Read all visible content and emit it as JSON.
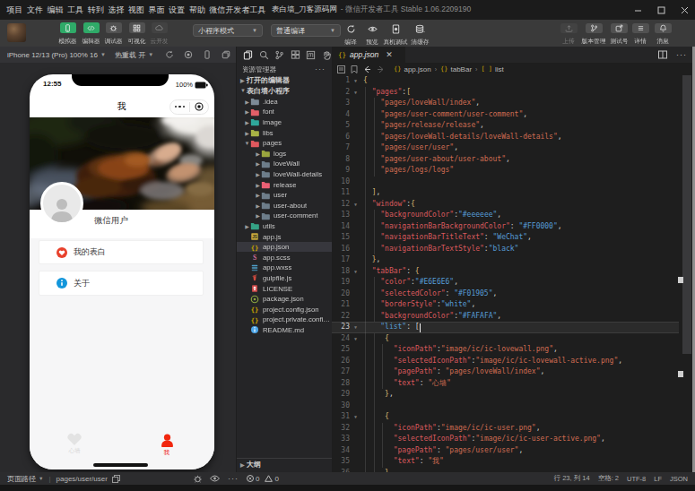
{
  "colors": {
    "accent_green": "#2faa68",
    "wechat_red": "#ee2a1d",
    "info_blue": "#1296db",
    "editor_key": "#d9595d",
    "editor_string": "#cf6c52",
    "editor_value_blue": "#569cd6",
    "editor_brace": "#d8b878"
  },
  "titlebar": {
    "menu": [
      "项目",
      "文件",
      "编辑",
      "工具",
      "转到",
      "选择",
      "视图",
      "界面",
      "设置",
      "帮助",
      "微信开发者工具"
    ],
    "title_main": "表白墙_刀客源码网",
    "title_sub": "- 微信开发者工具 Stable 1.06.2209190",
    "window_buttons": [
      "minimize",
      "maximize",
      "close"
    ]
  },
  "toolbar": {
    "mode_buttons": [
      {
        "label": "模拟器",
        "icon": "phone-icon",
        "state": "on"
      },
      {
        "label": "编辑器",
        "icon": "code-icon",
        "state": "on"
      },
      {
        "label": "调试器",
        "icon": "bug-icon",
        "state": "off"
      },
      {
        "label": "可视化",
        "icon": "grid-icon",
        "state": "off"
      },
      {
        "label": "云开发",
        "icon": "cloud-icon",
        "state": "disabled"
      }
    ],
    "selects": [
      {
        "value": "小程序模式"
      },
      {
        "value": "普通编译"
      }
    ],
    "action_buttons": [
      {
        "label": "编译",
        "icon": "compile-icon"
      },
      {
        "label": "预览",
        "icon": "eye-icon"
      },
      {
        "label": "真机调试",
        "icon": "device-debug-icon"
      },
      {
        "label": "清缓存",
        "icon": "cache-icon"
      }
    ],
    "right_buttons": [
      {
        "label": "上传",
        "icon": "upload-icon",
        "disabled": true
      },
      {
        "label": "版本管理",
        "icon": "branch-icon",
        "disabled": false
      },
      {
        "label": "测试号",
        "icon": "share-icon",
        "disabled": false
      },
      {
        "label": "详情",
        "icon": "details-icon",
        "disabled": false
      },
      {
        "label": "消息",
        "icon": "bell-icon",
        "disabled": false
      }
    ]
  },
  "simulator": {
    "device_label": "iPhone 12/13 (Pro) 100% 16",
    "hot_reload_label": "热重载 开",
    "header_icons": [
      "refresh-icon",
      "record-icon",
      "device-icon",
      "multi-window-icon"
    ],
    "phone": {
      "time": "12:55",
      "battery": "100%",
      "nav_title": "我",
      "user_name": "微信用户",
      "menu_items": [
        {
          "label": "我的表白",
          "icon": "heart-circle-icon"
        },
        {
          "label": "关于",
          "icon": "info-circle-icon"
        }
      ],
      "tabbar": [
        {
          "label": "心墙",
          "icon": "heart-icon",
          "active": false
        },
        {
          "label": "我",
          "icon": "user-icon",
          "active": true
        }
      ]
    },
    "page_path_label": "页面路径",
    "page_path": "pages/user/user"
  },
  "explorer": {
    "strip_icons": [
      "files-icon",
      "search-icon",
      "git-branch-icon",
      "extensions-icon",
      "npm-icon",
      "hand-icon"
    ],
    "header": "资源管理器",
    "sections": [
      "打开的编辑器",
      "表白墙小程序"
    ],
    "outline": "大纲",
    "problems": {
      "errors": "0",
      "warnings": "0"
    },
    "tree": [
      {
        "label": ".idea",
        "lvl": 1,
        "kind": "folder",
        "color": "#7d8a96",
        "arrow": "closed"
      },
      {
        "label": "font",
        "lvl": 1,
        "kind": "folder",
        "color": "#e25f68",
        "arrow": "closed"
      },
      {
        "label": "image",
        "lvl": 1,
        "kind": "folder",
        "color": "#2fa79b",
        "arrow": "closed"
      },
      {
        "label": "libs",
        "lvl": 1,
        "kind": "folder",
        "color": "#a8b345",
        "arrow": "closed"
      },
      {
        "label": "pages",
        "lvl": 1,
        "kind": "folder",
        "color": "#e0585e",
        "arrow": "open"
      },
      {
        "label": "logs",
        "lvl": 2,
        "kind": "folder",
        "color": "#9aa63e",
        "arrow": "closed"
      },
      {
        "label": "loveWall",
        "lvl": 2,
        "kind": "folder",
        "color": "#6d7d8a",
        "arrow": "closed"
      },
      {
        "label": "loveWall-details",
        "lvl": 2,
        "kind": "folder",
        "color": "#6d7d8a",
        "arrow": "closed"
      },
      {
        "label": "release",
        "lvl": 2,
        "kind": "folder",
        "color": "#ea5f74",
        "arrow": "closed"
      },
      {
        "label": "user",
        "lvl": 2,
        "kind": "folder",
        "color": "#6d7d8a",
        "arrow": "closed"
      },
      {
        "label": "user-about",
        "lvl": 2,
        "kind": "folder",
        "color": "#6d7d8a",
        "arrow": "closed"
      },
      {
        "label": "user-comment",
        "lvl": 2,
        "kind": "folder",
        "color": "#6d7d8a",
        "arrow": "closed"
      },
      {
        "label": "utils",
        "lvl": 1,
        "kind": "folder",
        "color": "#35a285",
        "arrow": "closed"
      },
      {
        "label": "app.js",
        "lvl": 1,
        "kind": "js",
        "color": "#c7a93c"
      },
      {
        "label": "app.json",
        "lvl": 1,
        "kind": "json",
        "color": "#cca700",
        "selected": true
      },
      {
        "label": "app.scss",
        "lvl": 1,
        "kind": "scss",
        "color": "#d16d9e"
      },
      {
        "label": "app.wxss",
        "lvl": 1,
        "kind": "wxss",
        "color": "#4f9fc9"
      },
      {
        "label": "gulpfile.js",
        "lvl": 1,
        "kind": "gulp",
        "color": "#cf4a3f"
      },
      {
        "label": "LICENSE",
        "lvl": 1,
        "kind": "license",
        "color": "#d04a4a"
      },
      {
        "label": "package.json",
        "lvl": 1,
        "kind": "npm",
        "color": "#8aa53f"
      },
      {
        "label": "project.config.json",
        "lvl": 1,
        "kind": "json",
        "color": "#cca700"
      },
      {
        "label": "project.private.config.js...",
        "lvl": 1,
        "kind": "json",
        "color": "#cca700"
      },
      {
        "label": "README.md",
        "lvl": 1,
        "kind": "readme",
        "color": "#4da6e8"
      }
    ]
  },
  "editor": {
    "tab": {
      "name": "app.json",
      "icon": "braces-icon"
    },
    "strip_icons": [
      "split-editor-icon",
      "more-icon"
    ],
    "breadcrumb_icons": [
      "list-flat-icon",
      "bookmark-icon",
      "arrow-left-icon",
      "arrow-right-icon"
    ],
    "breadcrumb": [
      {
        "icon": "{}",
        "label": "app.json"
      },
      {
        "icon": "{}",
        "label": "tabBar"
      },
      {
        "icon": "[ ]",
        "label": "list"
      }
    ],
    "cursor": {
      "line": "23",
      "col": "14"
    },
    "lines": [
      {
        "n": "1",
        "fold": true,
        "t": [
          [
            "brace",
            "{"
          ]
        ]
      },
      {
        "n": "2",
        "fold": true,
        "t": [
          [
            "punct",
            "  "
          ],
          [
            "key",
            "\"pages\""
          ],
          [
            "punct",
            ":"
          ],
          [
            "brace",
            "["
          ]
        ]
      },
      {
        "n": "3",
        "t": [
          [
            "punct",
            "    "
          ],
          [
            "str",
            "\"pages/loveWall/index\""
          ],
          [
            "punct",
            ","
          ]
        ]
      },
      {
        "n": "4",
        "t": [
          [
            "punct",
            "    "
          ],
          [
            "str",
            "\"pages/user-comment/user-comment\""
          ],
          [
            "punct",
            ","
          ]
        ]
      },
      {
        "n": "5",
        "t": [
          [
            "punct",
            "    "
          ],
          [
            "str",
            "\"pages/release/release\""
          ],
          [
            "punct",
            ","
          ]
        ]
      },
      {
        "n": "6",
        "t": [
          [
            "punct",
            "    "
          ],
          [
            "str",
            "\"pages/loveWall-details/loveWall-details\""
          ],
          [
            "punct",
            ","
          ]
        ]
      },
      {
        "n": "7",
        "t": [
          [
            "punct",
            "    "
          ],
          [
            "str",
            "\"pages/user/user\""
          ],
          [
            "punct",
            ","
          ]
        ]
      },
      {
        "n": "8",
        "t": [
          [
            "punct",
            "    "
          ],
          [
            "str",
            "\"pages/user-about/user-about\""
          ],
          [
            "punct",
            ","
          ]
        ]
      },
      {
        "n": "9",
        "t": [
          [
            "punct",
            "    "
          ],
          [
            "str",
            "\"pages/logs/logs\""
          ]
        ]
      },
      {
        "n": "10",
        "t": []
      },
      {
        "n": "11",
        "t": [
          [
            "punct",
            "  "
          ],
          [
            "brace",
            "]"
          ],
          [
            "punct",
            ","
          ]
        ]
      },
      {
        "n": "12",
        "fold": true,
        "t": [
          [
            "punct",
            "  "
          ],
          [
            "key",
            "\"window\""
          ],
          [
            "punct",
            ":"
          ],
          [
            "brace",
            "{"
          ]
        ]
      },
      {
        "n": "13",
        "t": [
          [
            "punct",
            "    "
          ],
          [
            "key",
            "\"backgroundColor\""
          ],
          [
            "punct",
            ":"
          ],
          [
            "blue",
            "\"#eeeeee\""
          ],
          [
            "punct",
            ","
          ]
        ]
      },
      {
        "n": "14",
        "t": [
          [
            "punct",
            "    "
          ],
          [
            "key",
            "\"navigationBarBackgroundColor\""
          ],
          [
            "punct",
            ": "
          ],
          [
            "blue",
            "\"#FF0000\""
          ],
          [
            "punct",
            ","
          ]
        ]
      },
      {
        "n": "15",
        "t": [
          [
            "punct",
            "    "
          ],
          [
            "key",
            "\"navigationBarTitleText\""
          ],
          [
            "punct",
            ": "
          ],
          [
            "blue",
            "\"WeChat\""
          ],
          [
            "punct",
            ","
          ]
        ]
      },
      {
        "n": "16",
        "t": [
          [
            "punct",
            "    "
          ],
          [
            "key",
            "\"navigationBarTextStyle\""
          ],
          [
            "punct",
            ":"
          ],
          [
            "blue",
            "\"black\""
          ]
        ]
      },
      {
        "n": "17",
        "t": [
          [
            "punct",
            "  "
          ],
          [
            "brace",
            "}"
          ],
          [
            "punct",
            ","
          ]
        ]
      },
      {
        "n": "18",
        "fold": true,
        "t": [
          [
            "punct",
            "  "
          ],
          [
            "key",
            "\"tabBar\""
          ],
          [
            "punct",
            ": "
          ],
          [
            "brace",
            "{"
          ]
        ]
      },
      {
        "n": "19",
        "t": [
          [
            "punct",
            "    "
          ],
          [
            "key",
            "\"color\""
          ],
          [
            "punct",
            ":"
          ],
          [
            "blue",
            "\"#E6E6E6\""
          ],
          [
            "punct",
            ","
          ]
        ]
      },
      {
        "n": "20",
        "t": [
          [
            "punct",
            "    "
          ],
          [
            "key",
            "\"selectedColor\""
          ],
          [
            "punct",
            ": "
          ],
          [
            "blue",
            "\"#F01905\""
          ],
          [
            "punct",
            ","
          ]
        ]
      },
      {
        "n": "21",
        "t": [
          [
            "punct",
            "    "
          ],
          [
            "key",
            "\"borderStyle\""
          ],
          [
            "punct",
            ":"
          ],
          [
            "blue",
            "\"white\""
          ],
          [
            "punct",
            ","
          ]
        ]
      },
      {
        "n": "22",
        "t": [
          [
            "punct",
            "    "
          ],
          [
            "key",
            "\"backgroundColor\""
          ],
          [
            "punct",
            ":"
          ],
          [
            "blue",
            "\"#FAFAFA\""
          ],
          [
            "punct",
            ","
          ]
        ]
      },
      {
        "n": "23",
        "fold": true,
        "cur": true,
        "t": [
          [
            "punct",
            "    "
          ],
          [
            "blue",
            "\"list\""
          ],
          [
            "punct",
            ": "
          ],
          [
            "punct",
            "["
          ]
        ]
      },
      {
        "n": "24",
        "fold": true,
        "t": [
          [
            "punct",
            "     "
          ],
          [
            "brace",
            "{"
          ]
        ]
      },
      {
        "n": "25",
        "t": [
          [
            "punct",
            "       "
          ],
          [
            "key",
            "\"iconPath\""
          ],
          [
            "punct",
            ":"
          ],
          [
            "str",
            "\"image/ic/ic-lovewall.png\""
          ],
          [
            "punct",
            ","
          ]
        ]
      },
      {
        "n": "26",
        "t": [
          [
            "punct",
            "       "
          ],
          [
            "key",
            "\"selectedIconPath\""
          ],
          [
            "punct",
            ":"
          ],
          [
            "str",
            "\"image/ic/ic-lovewall-active.png\""
          ],
          [
            "punct",
            ","
          ]
        ]
      },
      {
        "n": "27",
        "t": [
          [
            "punct",
            "       "
          ],
          [
            "key",
            "\"pagePath\""
          ],
          [
            "punct",
            ": "
          ],
          [
            "str",
            "\"pages/loveWall/index\""
          ],
          [
            "punct",
            ","
          ]
        ]
      },
      {
        "n": "28",
        "t": [
          [
            "punct",
            "       "
          ],
          [
            "key",
            "\"text\""
          ],
          [
            "punct",
            ": "
          ],
          [
            "str",
            "\"心墙\""
          ]
        ]
      },
      {
        "n": "29",
        "t": [
          [
            "punct",
            "     "
          ],
          [
            "brace",
            "}"
          ],
          [
            "punct",
            ","
          ]
        ]
      },
      {
        "n": "30",
        "t": []
      },
      {
        "n": "31",
        "fold": true,
        "t": [
          [
            "punct",
            "     "
          ],
          [
            "brace",
            "{"
          ]
        ]
      },
      {
        "n": "32",
        "t": [
          [
            "punct",
            "       "
          ],
          [
            "key",
            "\"iconPath\""
          ],
          [
            "punct",
            ":"
          ],
          [
            "str",
            "\"image/ic/ic-user.png\""
          ],
          [
            "punct",
            ","
          ]
        ]
      },
      {
        "n": "33",
        "t": [
          [
            "punct",
            "       "
          ],
          [
            "key",
            "\"selectedIconPath\""
          ],
          [
            "punct",
            ":"
          ],
          [
            "str",
            "\"image/ic/ic-user-active.png\""
          ],
          [
            "punct",
            ","
          ]
        ]
      },
      {
        "n": "34",
        "t": [
          [
            "punct",
            "       "
          ],
          [
            "key",
            "\"pagePath\""
          ],
          [
            "punct",
            ": "
          ],
          [
            "str",
            "\"pages/user/user\""
          ],
          [
            "punct",
            ","
          ]
        ]
      },
      {
        "n": "35",
        "t": [
          [
            "punct",
            "       "
          ],
          [
            "key",
            "\"text\""
          ],
          [
            "punct",
            ": "
          ],
          [
            "str",
            "\"我\""
          ]
        ]
      },
      {
        "n": "36",
        "t": [
          [
            "punct",
            "     "
          ],
          [
            "brace",
            "}"
          ]
        ]
      }
    ]
  },
  "statusbar": {
    "mid_icons": [
      "bug-icon",
      "eye-icon",
      "more-icon"
    ],
    "position": "行 23, 列 14",
    "indent": "空格: 2",
    "encoding": "UTF-8",
    "eol": "LF",
    "language": "JSON"
  }
}
